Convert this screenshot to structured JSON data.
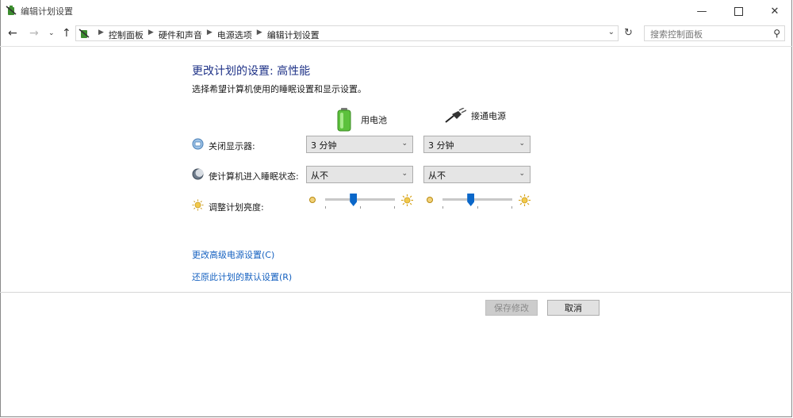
{
  "window": {
    "title": "编辑计划设置"
  },
  "nav": {
    "breadcrumbs": [
      "控制面板",
      "硬件和声音",
      "电源选项",
      "编辑计划设置"
    ],
    "search_placeholder": "搜索控制面板"
  },
  "main": {
    "heading": "更改计划的设置: 高性能",
    "subtitle": "选择希望计算机使用的睡眠设置和显示设置。",
    "columns": {
      "battery": "用电池",
      "plugged": "接通电源"
    },
    "rows": {
      "display_off": {
        "label": "关闭显示器:",
        "battery": "3 分钟",
        "plugged": "3 分钟"
      },
      "sleep": {
        "label": "使计算机进入睡眠状态:",
        "battery": "从不",
        "plugged": "从不"
      },
      "brightness": {
        "label": "调整计划亮度:",
        "battery_level": 0.4,
        "plugged_level": 0.4
      }
    },
    "links": {
      "advanced": "更改高级电源设置(C)",
      "restore": "还原此计划的默认设置(R)"
    },
    "buttons": {
      "save": "保存修改",
      "cancel": "取消"
    }
  },
  "colors": {
    "heading": "#1e3287",
    "link": "#1561c0",
    "slider_thumb": "#0a67c9"
  }
}
